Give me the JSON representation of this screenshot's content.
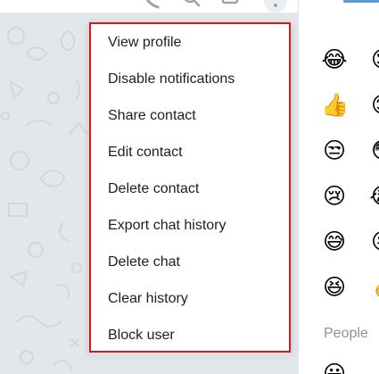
{
  "menu": {
    "items": [
      {
        "id": "view-profile",
        "label": "View profile"
      },
      {
        "id": "disable-notifications",
        "label": "Disable notifications"
      },
      {
        "id": "share-contact",
        "label": "Share contact"
      },
      {
        "id": "edit-contact",
        "label": "Edit contact"
      },
      {
        "id": "delete-contact",
        "label": "Delete contact"
      },
      {
        "id": "export-chat-history",
        "label": "Export chat history"
      },
      {
        "id": "delete-chat",
        "label": "Delete chat"
      },
      {
        "id": "clear-history",
        "label": "Clear history"
      },
      {
        "id": "block-user",
        "label": "Block user"
      }
    ],
    "highlight_color": "#d6191f"
  },
  "emoji_panel": {
    "section_label": "People",
    "accent_color": "#5b9bd5",
    "emojis": [
      {
        "name": "face-with-tears-of-joy-icon"
      },
      {
        "name": "thumbs-up-icon"
      },
      {
        "name": "unamused-face-icon"
      },
      {
        "name": "crying-face-icon"
      },
      {
        "name": "grinning-face-with-sweat-icon"
      },
      {
        "name": "grinning-squinting-face-icon"
      }
    ]
  },
  "header": {
    "icons": [
      "phone-icon",
      "search-icon",
      "sidebar-toggle-icon",
      "more-options-icon"
    ]
  }
}
